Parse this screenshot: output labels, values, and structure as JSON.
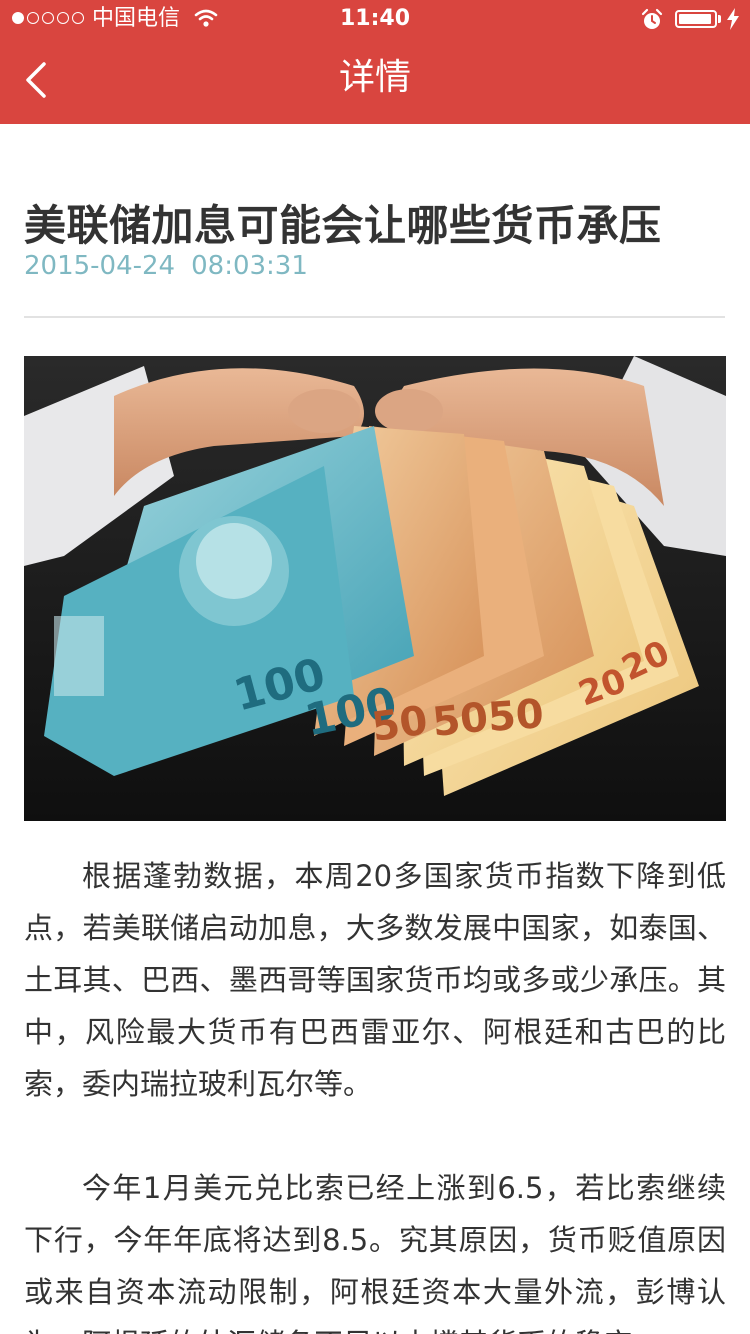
{
  "status_bar": {
    "carrier": "中国电信",
    "time": "11:40",
    "battery_level": 0.95,
    "signal_bars": 1
  },
  "nav": {
    "title": "详情",
    "back_icon": "chevron-left-icon"
  },
  "article": {
    "title": "美联储加息可能会让哪些货币承压",
    "date": "2015-04-24",
    "time": "08:03:31",
    "paragraphs": [
      "根据蓬勃数据，本周20多国家货币指数下降到低点，若美联储启动加息，大多数发展中国家，如泰国、土耳其、巴西、墨西哥等国家货币均或多或少承压。其中，风险最大货币有巴西雷亚尔、阿根廷和古巴的比索，委内瑞拉玻利瓦尔等。",
      "今年1月美元兑比索已经上涨到6.5，若比索继续下行，今年年底将达到8.5。究其原因，货币贬值原因或来自资本流动限制，阿根廷资本大量外流，彭博认为，阿根廷的外汇储备不足以支撑其货币的稳定。"
    ]
  },
  "colors": {
    "accent": "#d9453f",
    "date": "#7fb8c2",
    "text": "#333333"
  }
}
